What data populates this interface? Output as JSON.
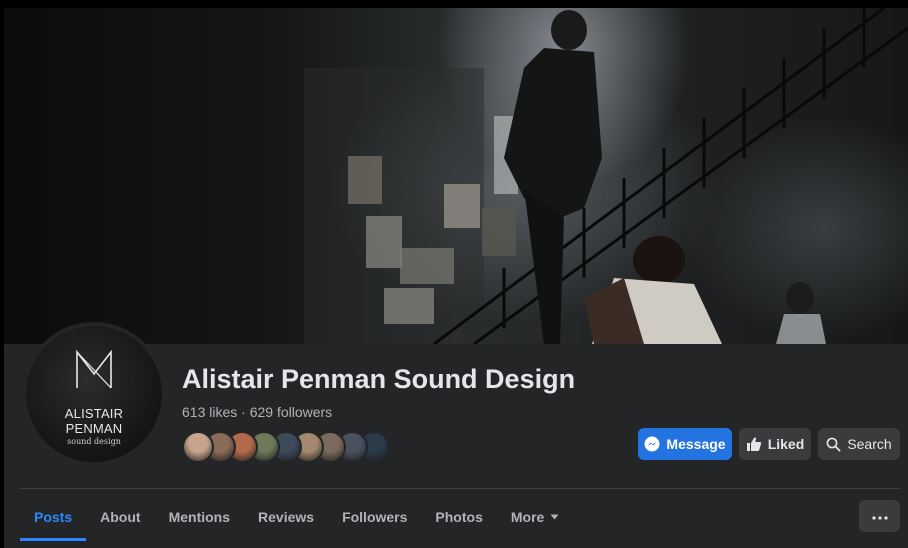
{
  "page": {
    "title": "Alistair Penman Sound Design",
    "stats": "613 likes · 629 followers"
  },
  "avatar": {
    "line1": "ALISTAIR",
    "line2": "PENMAN",
    "line3": "sound design"
  },
  "friends": {
    "colors": [
      "#c9a48c",
      "#8a6a58",
      "#b26a4c",
      "#6c7a5a",
      "#3c4a5a",
      "#a48870",
      "#7c6a5c",
      "#4a5260",
      "#2c3a4a"
    ]
  },
  "actions": {
    "message_label": "Message",
    "liked_label": "Liked",
    "search_label": "Search"
  },
  "tabs": [
    {
      "label": "Posts",
      "active": true
    },
    {
      "label": "About"
    },
    {
      "label": "Mentions"
    },
    {
      "label": "Reviews"
    },
    {
      "label": "Followers"
    },
    {
      "label": "Photos"
    },
    {
      "label": "More"
    }
  ],
  "colors": {
    "accent": "#2374e1",
    "tab_active": "#2d88ff",
    "panel_bg": "#242526",
    "button_bg": "#3a3b3c"
  }
}
